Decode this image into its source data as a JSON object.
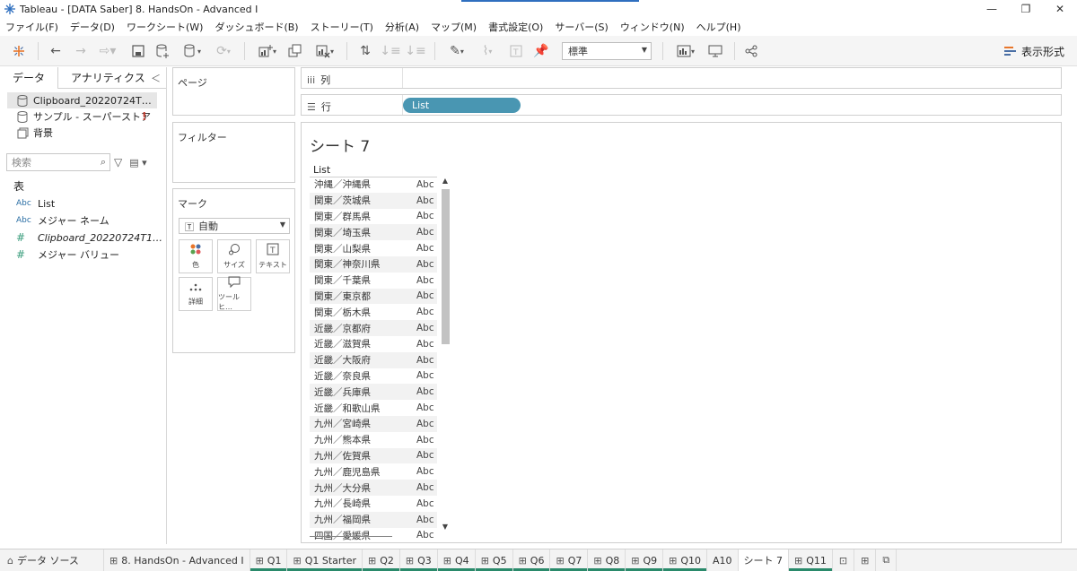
{
  "window": {
    "title": "Tableau - [DATA Saber] 8. HandsOn - Advanced I",
    "controls": [
      "minimize",
      "restore",
      "close"
    ]
  },
  "menu": [
    "ファイル(F)",
    "データ(D)",
    "ワークシート(W)",
    "ダッシュボード(B)",
    "ストーリー(T)",
    "分析(A)",
    "マップ(M)",
    "書式設定(O)",
    "サーバー(S)",
    "ウィンドウ(N)",
    "ヘルプ(H)"
  ],
  "toolbar": {
    "mark_size_select": "標準",
    "show_me_label": "表示形式"
  },
  "left_panel": {
    "tabs": [
      "データ",
      "アナリティクス"
    ],
    "data_sources": [
      {
        "label": "Clipboard_20220724T…",
        "icon": "database-icon"
      },
      {
        "label": "サンプル - スーパーストア",
        "icon": "database-icon",
        "warning": "!"
      },
      {
        "label": "背景",
        "icon": "background-icon"
      }
    ],
    "search_placeholder": "検索",
    "section_header": "表",
    "fields": [
      {
        "type": "Abc",
        "label": "List"
      },
      {
        "type": "Abc",
        "label": "メジャー ネーム"
      },
      {
        "type": "#",
        "label": "Clipboard_20220724T1…"
      },
      {
        "type": "#",
        "label": "メジャー バリュー"
      }
    ]
  },
  "cards": {
    "pages": "ページ",
    "filters": "フィルター",
    "marks": "マーク",
    "marks_type": "自動",
    "mark_buttons": [
      {
        "label": "色",
        "icon": "color-icon"
      },
      {
        "label": "サイズ",
        "icon": "size-icon"
      },
      {
        "label": "テキスト",
        "icon": "text-icon"
      },
      {
        "label": "詳細",
        "icon": "detail-icon"
      },
      {
        "label": "ツールヒ…",
        "icon": "tooltip-icon"
      }
    ]
  },
  "shelves": {
    "columns_label": "列",
    "rows_label": "行",
    "rows_pill": "List"
  },
  "sheet": {
    "title": "シート 7",
    "column_header": "List",
    "rows": [
      "沖縄／沖縄県",
      "関東／茨城県",
      "関東／群馬県",
      "関東／埼玉県",
      "関東／山梨県",
      "関東／神奈川県",
      "関東／千葉県",
      "関東／東京都",
      "関東／栃木県",
      "近畿／京都府",
      "近畿／滋賀県",
      "近畿／大阪府",
      "近畿／奈良県",
      "近畿／兵庫県",
      "近畿／和歌山県",
      "九州／宮崎県",
      "九州／熊本県",
      "九州／佐賀県",
      "九州／鹿児島県",
      "九州／大分県",
      "九州／長崎県",
      "九州／福岡県",
      "四国／愛媛県"
    ],
    "cell_value": "Abc"
  },
  "tabs": [
    {
      "label": "データ ソース",
      "icon": "datasource-icon",
      "active": false,
      "underline": false
    },
    {
      "label": "8. HandsOn - Advanced I",
      "icon": "sheet-icon",
      "active": false,
      "underline": false
    },
    {
      "label": "Q1",
      "icon": "sheet-icon",
      "active": false,
      "underline": true
    },
    {
      "label": "Q1 Starter",
      "icon": "sheet-icon",
      "active": false,
      "underline": true
    },
    {
      "label": "Q2",
      "icon": "sheet-icon",
      "active": false,
      "underline": true
    },
    {
      "label": "Q3",
      "icon": "sheet-icon",
      "active": false,
      "underline": true
    },
    {
      "label": "Q4",
      "icon": "sheet-icon",
      "active": false,
      "underline": true
    },
    {
      "label": "Q5",
      "icon": "sheet-icon",
      "active": false,
      "underline": true
    },
    {
      "label": "Q6",
      "icon": "sheet-icon",
      "active": false,
      "underline": true
    },
    {
      "label": "Q7",
      "icon": "sheet-icon",
      "active": false,
      "underline": true
    },
    {
      "label": "Q8",
      "icon": "sheet-icon",
      "active": false,
      "underline": true
    },
    {
      "label": "Q9",
      "icon": "sheet-icon",
      "active": false,
      "underline": true
    },
    {
      "label": "Q10",
      "icon": "sheet-icon",
      "active": false,
      "underline": true
    },
    {
      "label": "A10",
      "icon": "",
      "active": false,
      "underline": false
    },
    {
      "label": "シート 7",
      "icon": "",
      "active": true,
      "underline": false
    },
    {
      "label": "Q11",
      "icon": "sheet-icon",
      "active": false,
      "underline": true
    }
  ],
  "colors": {
    "pill": "#4996b2",
    "tab_underline": "#2a8a6b",
    "warning": "#c0392b"
  }
}
